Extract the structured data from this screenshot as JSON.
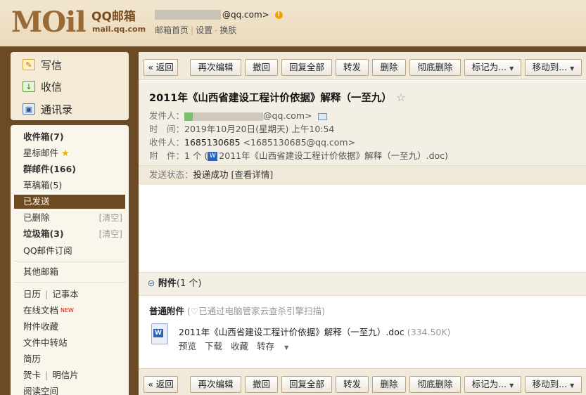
{
  "header": {
    "logo_text": "MOil",
    "logo_title": "QQ邮箱",
    "logo_subtitle": "mail.qq.com",
    "account_suffix": "@qq.com>",
    "warn_symbol": "!",
    "links": [
      "邮箱首页",
      "设置",
      "换肤"
    ]
  },
  "sidebar": {
    "quick": [
      {
        "label": "写信",
        "icon": "compose-icon"
      },
      {
        "label": "收信",
        "icon": "receive-icon"
      },
      {
        "label": "通讯录",
        "icon": "contacts-icon"
      }
    ],
    "folders": {
      "inbox": "收件箱(7)",
      "starred": "星标邮件",
      "group": "群邮件(166)",
      "drafts": "草稿箱(5)",
      "sent": "已发送",
      "deleted": "已删除",
      "deleted_clear": "[清空]",
      "spam": "垃圾箱(3)",
      "spam_clear": "[清空]",
      "subscriptions": "QQ邮件订阅",
      "other": "其他邮箱",
      "calendar": "日历",
      "notes": "记事本",
      "docs": "在线文档",
      "docs_badge": "NEW",
      "attachments": "附件收藏",
      "transfer": "文件中转站",
      "resume": "简历",
      "cards": "贺卡",
      "postcards": "明信片",
      "reading": "阅读空间"
    }
  },
  "toolbar": {
    "back": "« 返回",
    "reedit": "再次编辑",
    "recall": "撤回",
    "reply_all": "回复全部",
    "forward": "转发",
    "delete": "删除",
    "delete_permanent": "彻底删除",
    "mark_as": "标记为...",
    "move_to": "移动到..."
  },
  "mail": {
    "subject": "2011年《山西省建设工程计价依据》解释（一至九）",
    "star": "☆",
    "from_label": "发件人：",
    "from_suffix": "@qq.com>",
    "time_label": "时　间：",
    "time_value": "2019年10月20日(星期天) 上午10:54",
    "to_label": "收件人：",
    "to_name": "1685130685",
    "to_addr": "<1685130685@qq.com>",
    "attach_label": "附　件：",
    "attach_value_prefix": "1 个 (",
    "attach_value_name": "2011年《山西省建设工程计价依据》解释（一至九）.doc)",
    "status_label": "发送状态：",
    "status_value": "投递成功",
    "status_link": "[查看详情]"
  },
  "attachments": {
    "title": "附件",
    "count": "(1 个)",
    "section_label": "普通附件",
    "scan_note": "(♡已通过电脑管家云查杀引擎扫描)",
    "file_name": "2011年《山西省建设工程计价依据》解释（一至九）.doc",
    "file_size": "(334.50K)",
    "actions": [
      "预览",
      "下载",
      "收藏",
      "转存"
    ]
  }
}
